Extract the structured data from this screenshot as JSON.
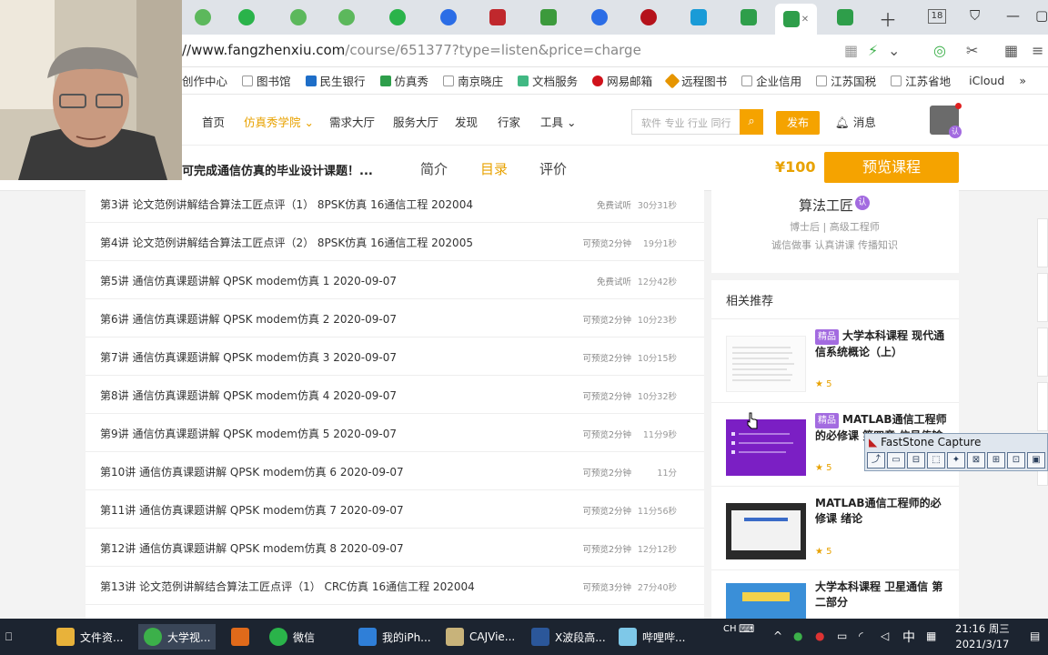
{
  "browser": {
    "url_main": "//www.fangzhenxiu.com",
    "url_rest": "/course/651377?type=listen&price=charge",
    "tab_count": "18",
    "bookmarks": [
      "创作中心",
      "图书馆",
      "民生银行",
      "仿真秀",
      "南京晓庄",
      "文档服务",
      "网易邮箱",
      "远程图书",
      "企业信用",
      "江苏国税",
      "江苏省地",
      "iCloud"
    ]
  },
  "site_nav": {
    "items": [
      "首页",
      "仿真秀学院",
      "需求大厅",
      "服务大厅",
      "发现",
      "行家",
      "工具"
    ],
    "search_placeholder": "软件 专业 行业 同行",
    "publish": "发布",
    "messages": "消息",
    "avatar_badge": "认"
  },
  "course_header": {
    "title": "可完成通信仿真的毕业设计课题！...",
    "tabs": [
      "简介",
      "目录",
      "评价"
    ],
    "price": "¥100",
    "preview_button": "预览课程"
  },
  "lessons": [
    {
      "title": "第3讲   论文范例讲解结合算法工匠点评（1） 8PSK仿真 16通信工程 202004",
      "preview": "免费试听",
      "duration": "30分31秒"
    },
    {
      "title": "第4讲   论文范例讲解结合算法工匠点评（2） 8PSK仿真 16通信工程 202005",
      "preview": "可预览2分钟",
      "duration": "19分1秒"
    },
    {
      "title": "第5讲   通信仿真课题讲解 QPSK modem仿真 1 2020-09-07",
      "preview": "免费试听",
      "duration": "12分42秒"
    },
    {
      "title": "第6讲   通信仿真课题讲解 QPSK modem仿真 2 2020-09-07",
      "preview": "可预览2分钟",
      "duration": "10分23秒"
    },
    {
      "title": "第7讲   通信仿真课题讲解 QPSK modem仿真 3 2020-09-07",
      "preview": "可预览2分钟",
      "duration": "10分15秒"
    },
    {
      "title": "第8讲   通信仿真课题讲解 QPSK modem仿真 4 2020-09-07",
      "preview": "可预览2分钟",
      "duration": "10分32秒"
    },
    {
      "title": "第9讲   通信仿真课题讲解 QPSK modem仿真 5 2020-09-07",
      "preview": "可预览2分钟",
      "duration": "11分9秒"
    },
    {
      "title": "第10讲   通信仿真课题讲解 QPSK modem仿真 6 2020-09-07",
      "preview": "可预览2分钟",
      "duration": "11分"
    },
    {
      "title": "第11讲   通信仿真课题讲解 QPSK modem仿真 7 2020-09-07",
      "preview": "可预览2分钟",
      "duration": "11分56秒"
    },
    {
      "title": "第12讲   通信仿真课题讲解 QPSK modem仿真 8 2020-09-07",
      "preview": "可预览2分钟",
      "duration": "12分12秒"
    },
    {
      "title": "第13讲   论文范例讲解结合算法工匠点评（1） CRC仿真 16通信工程 202004",
      "preview": "可预览3分钟",
      "duration": "27分40秒"
    }
  ],
  "author": {
    "name": "算法工匠",
    "badge": "认",
    "title": "博士后 | 高级工程师",
    "motto": "诚信做事 认真讲课 传播知识"
  },
  "recommendations": {
    "heading": "相关推荐",
    "items": [
      {
        "tag": "精品",
        "title": "大学本科课程 现代通信系统概论（上）",
        "rating": "5"
      },
      {
        "tag": "精品",
        "title": "MATLAB通信工程师的必修课 第四章 信号传输",
        "rating": "5"
      },
      {
        "tag": "",
        "title": "MATLAB通信工程师的必修课 绪论",
        "rating": "5"
      },
      {
        "tag": "",
        "title": "大学本科课程 卫星通信 第二部分",
        "rating": ""
      }
    ]
  },
  "faststone": {
    "title": "FastStone Capture"
  },
  "taskbar": {
    "apps": [
      "文件资...",
      "大学视...",
      "",
      "微信",
      "我的iPh...",
      "CAJVie...",
      "X波段高...",
      "哔哩哔..."
    ],
    "ime_mode": "CH",
    "ime_lang": "中",
    "time": "21:16 周三",
    "date": "2021/3/17"
  }
}
